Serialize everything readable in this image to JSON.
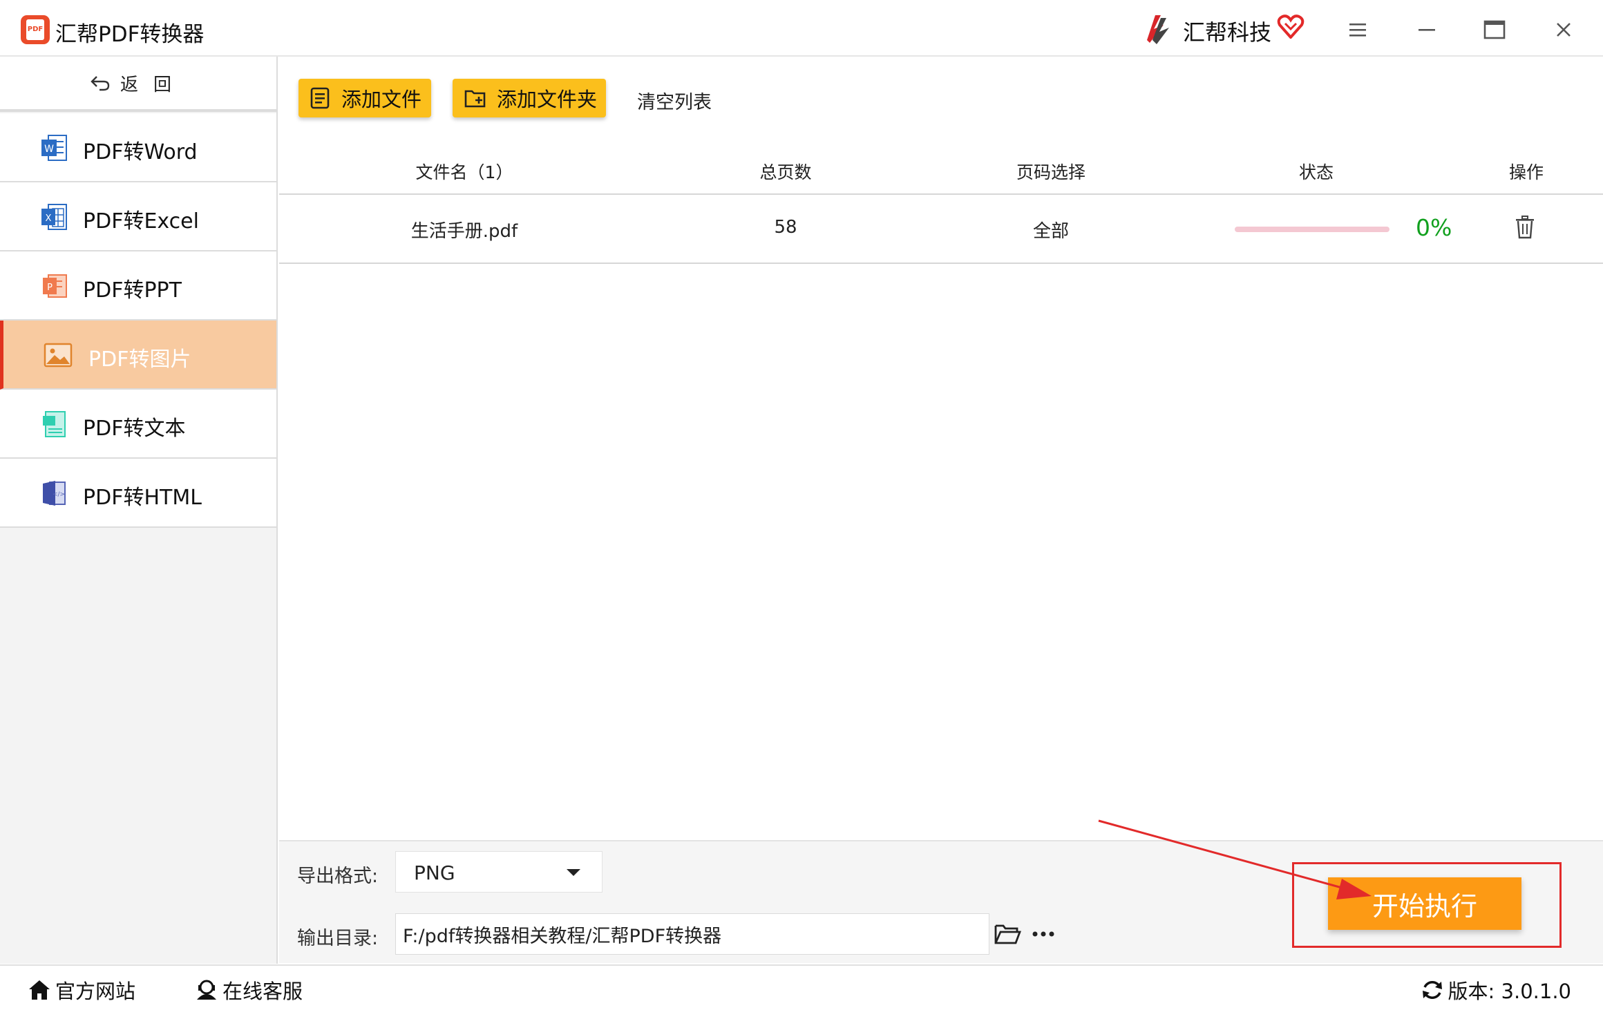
{
  "app": {
    "title": "汇帮PDF转换器",
    "logo_text": "PDF",
    "brand": "汇帮科技"
  },
  "icons": {
    "app_logo": "pdf-app-icon",
    "brand_logo": "huibang-brand-icon",
    "vip": "heart-vip-icon",
    "window": [
      "menu-icon",
      "minimize-icon",
      "maximize-icon",
      "close-icon"
    ]
  },
  "sidebar": {
    "back_label": "返回",
    "items": [
      {
        "label": "PDF转Word",
        "icon": "word-icon"
      },
      {
        "label": "PDF转Excel",
        "icon": "excel-icon"
      },
      {
        "label": "PDF转PPT",
        "icon": "ppt-icon"
      },
      {
        "label": "PDF转图片",
        "icon": "image-icon",
        "active": true
      },
      {
        "label": "PDF转文本",
        "icon": "text-icon"
      },
      {
        "label": "PDF转HTML",
        "icon": "html-icon"
      }
    ]
  },
  "toolbar": {
    "add_file": "添加文件",
    "add_folder": "添加文件夹",
    "clear_list": "清空列表"
  },
  "table": {
    "headers": [
      "文件名（1）",
      "总页数",
      "页码选择",
      "状态",
      "操作"
    ],
    "rows": [
      {
        "filename": "生活手册.pdf",
        "pages": "58",
        "page_range": "全部",
        "progress": 0,
        "progress_text": "0%"
      }
    ]
  },
  "settings": {
    "format_label": "导出格式:",
    "format_value": "PNG",
    "output_label": "输出目录:",
    "output_value": "F:/pdf转换器相关教程/汇帮PDF转换器",
    "start_button": "开始执行"
  },
  "statusbar": {
    "website": "官方网站",
    "service": "在线客服",
    "version": "版本:  3.0.1.0"
  },
  "colors": {
    "accent_yellow": "#fbbf1c",
    "start_orange": "#fd9a14",
    "active_nav": "#f8caa0",
    "active_border": "#e0331f",
    "progress_green": "#11a01e",
    "annotation_red": "#e22a2a"
  }
}
